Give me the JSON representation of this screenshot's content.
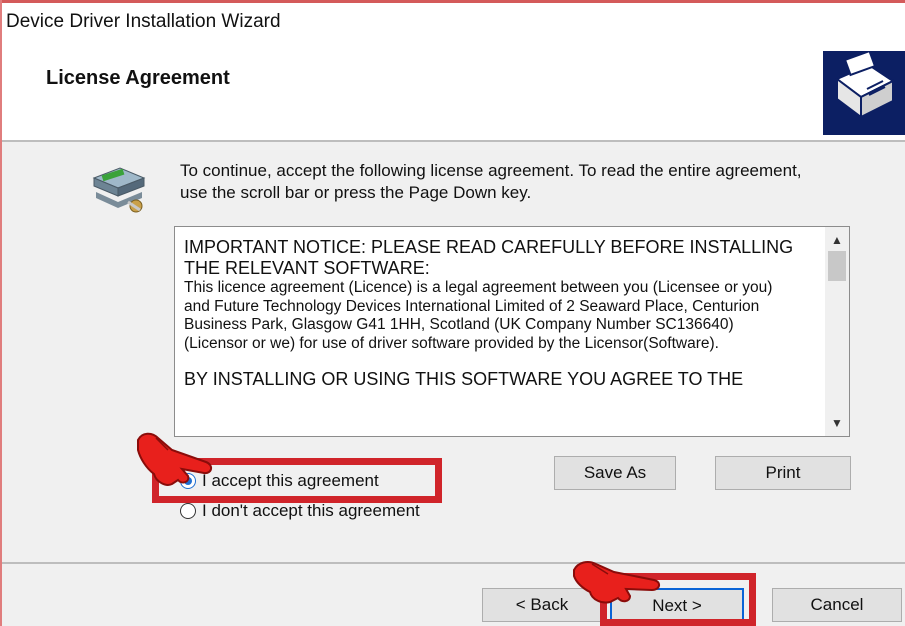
{
  "window": {
    "title": "Device Driver Installation Wizard"
  },
  "header": {
    "title": "License Agreement",
    "icon": "hardware-install-icon"
  },
  "body": {
    "icon": "installer-icon",
    "instructions": "To continue, accept the following license agreement. To read the entire agreement, use the scroll bar or press the Page Down key.",
    "license": {
      "heading": "IMPORTANT NOTICE: PLEASE READ CAREFULLY BEFORE INSTALLING THE RELEVANT SOFTWARE:",
      "paragraph": "This licence agreement (Licence) is a legal agreement between you (Licensee or you) and Future Technology Devices International Limited of 2 Seaward Place, Centurion Business Park, Glasgow G41 1HH, Scotland (UK Company Number SC136640) (Licensor or we) for use of driver software provided by the Licensor(Software).",
      "closing": "BY INSTALLING OR USING THIS SOFTWARE YOU AGREE TO THE"
    },
    "save_as_label": "Save As",
    "print_label": "Print",
    "accept_label": "I accept this agreement",
    "decline_label": "I don't accept this agreement",
    "accept_selected": true
  },
  "footer": {
    "back_label": "< Back",
    "next_label": "Next >",
    "cancel_label": "Cancel"
  },
  "annotations": {
    "highlight_color": "#d0242a",
    "pointer_color": "#e8201c"
  }
}
